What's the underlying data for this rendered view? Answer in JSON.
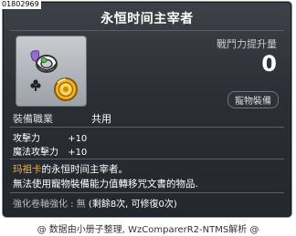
{
  "item_id": "01802969",
  "title": "永恒时间主宰者",
  "power": {
    "label": "戰鬥力提升量",
    "value": "0"
  },
  "pet_badge": "寵物裝備",
  "job": {
    "label": "裝備職業",
    "value": "共用"
  },
  "stats": [
    {
      "name": "攻擊力",
      "value": "+10"
    },
    {
      "name": "魔法攻擊力",
      "value": "+10"
    }
  ],
  "description": {
    "highlight": "玛祖卡",
    "line1_rest": "的永恒时间主宰者。",
    "line2": "無法使用寵物裝備能力值轉移咒文書的物品."
  },
  "enhance": {
    "label": "強化卷軸強化 : 無",
    "detail": "(剩餘8次, 可修復0次)"
  },
  "footer": "@ 数据由小册子整理, WzComparerR2-NTMS解析 @",
  "icon": "pet-ring-equipment-icon"
}
